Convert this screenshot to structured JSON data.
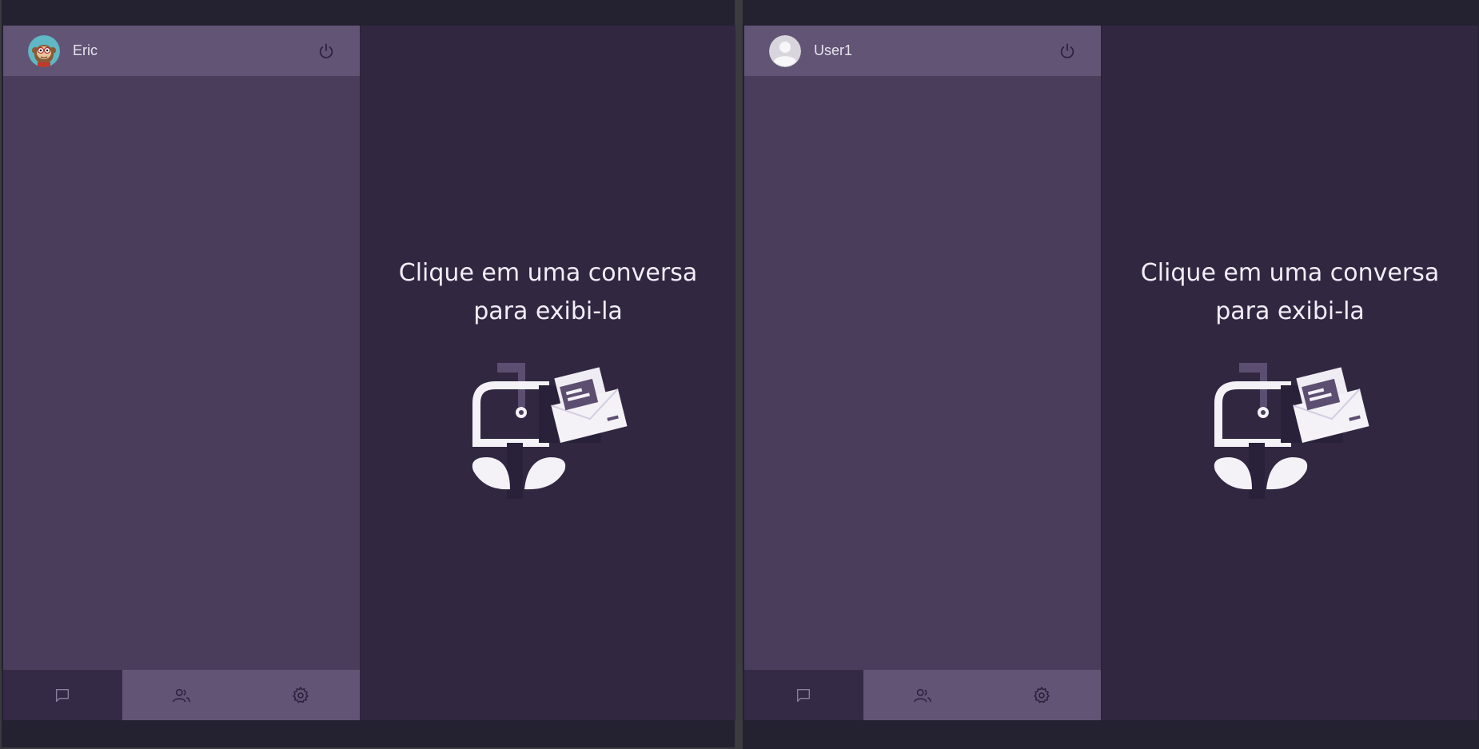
{
  "windows": [
    {
      "user": {
        "name": "Eric",
        "avatar": "monkey-avatar"
      },
      "main": {
        "line1": "Clique em uma conversa",
        "line2": "para exibi-la",
        "illustration": "mailbox-icon"
      },
      "nav": [
        {
          "icon": "chat-icon",
          "active": true
        },
        {
          "icon": "users-icon",
          "active": false
        },
        {
          "icon": "gear-icon",
          "active": false
        }
      ]
    },
    {
      "user": {
        "name": "User1",
        "avatar": "default-user-avatar"
      },
      "main": {
        "line1": "Clique em uma conversa",
        "line2": "para exibi-la",
        "illustration": "mailbox-icon"
      },
      "nav": [
        {
          "icon": "chat-icon",
          "active": true
        },
        {
          "icon": "users-icon",
          "active": false
        },
        {
          "icon": "gear-icon",
          "active": false
        }
      ]
    }
  ],
  "colors": {
    "sidebar_header": "#625475",
    "sidebar_body": "#4a3d5b",
    "main_bg": "#322741",
    "active_nav": "#352a45"
  }
}
